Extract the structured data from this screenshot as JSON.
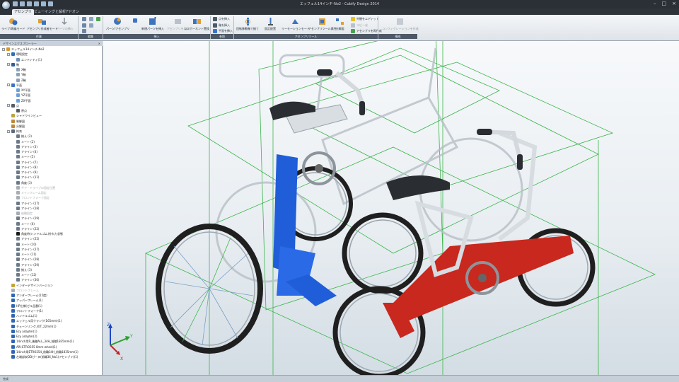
{
  "window": {
    "title": "エッフェル14インチ-No2 - Cubify Design 2014"
  },
  "tabs": [
    {
      "label": "アセンブリ"
    },
    {
      "label": "ビューイングと解析"
    },
    {
      "label": "アドオン"
    }
  ],
  "ribbon": {
    "buttons": {
      "insert_mode": "ライブ/再編モード",
      "assembly_mode": "アセンブリ作成者モード",
      "part_insert": "パーツの挿入",
      "parts_assembly": "パーツ/アセンブリ",
      "new_part_insert": "新規パーツを挿入",
      "create_assembly": "アセンブリを作成",
      "component_replace": "コンポーネント置換",
      "rotate_align": "回転移動軸で揃て",
      "fixed_place": "固定配置",
      "motion_mode": "リーモーションモード",
      "assembly_tools": "アセンブリツール属性",
      "analysis": "分解図",
      "reconfigure": "コンフィグレーションを作成"
    },
    "small": {
      "point_insert": "点を挿入",
      "axis_insert": "軸を挿入",
      "plane_insert": "平面を挿入",
      "color_edit": "外観をエディット",
      "xcopy": "コピー化",
      "regenerate": "アセンブリを再作成"
    },
    "groups": {
      "work": "作業",
      "edit": "編集",
      "insert": "挿入",
      "reference": "参照",
      "assembly_tools": "アセンブリツール",
      "configuration": "構成"
    }
  },
  "panel": {
    "title": "デザインエクスプローラー"
  },
  "tree": [
    {
      "label": "エッフェル14インチ-No2",
      "level": 0,
      "expanded": true,
      "icon_color": "#d79a2a"
    },
    {
      "label": "環境設定",
      "level": 1,
      "expanded": true,
      "icon_color": "#2a6fb7"
    },
    {
      "label": "エンティティ(1)",
      "level": 2,
      "icon_color": "#6d8fb6"
    },
    {
      "label": "軸",
      "level": 1,
      "expanded": true,
      "icon_color": "#2f5c9a"
    },
    {
      "label": "X軸",
      "level": 2,
      "icon_color": "#8aa1b8"
    },
    {
      "label": "Y軸",
      "level": 2,
      "icon_color": "#8aa1b8"
    },
    {
      "label": "Z軸",
      "level": 2,
      "icon_color": "#8aa1b8"
    },
    {
      "label": "平面",
      "level": 1,
      "expanded": true,
      "icon_color": "#3b72c5"
    },
    {
      "label": "XY平面",
      "level": 2,
      "icon_color": "#6d9fd8"
    },
    {
      "label": "YZ平面",
      "level": 2,
      "icon_color": "#6d9fd8"
    },
    {
      "label": "ZX平面",
      "level": 2,
      "icon_color": "#6d9fd8"
    },
    {
      "label": "点",
      "level": 1,
      "expanded": true,
      "icon_color": "#555b63"
    },
    {
      "label": "原点",
      "level": 2,
      "icon_color": "#555b63"
    },
    {
      "label": "シャドウインビュー",
      "level": 1,
      "icon_color": "#b8a640"
    },
    {
      "label": "制御図",
      "level": 1,
      "icon_color": "#c0863a"
    },
    {
      "label": "分解図",
      "level": 1,
      "icon_color": "#c0863a"
    },
    {
      "label": "拘束",
      "level": 1,
      "expanded": true,
      "icon_color": "#5a6b7d"
    },
    {
      "label": "揃え (2)",
      "level": 2,
      "icon_color": "#6b7a8a"
    },
    {
      "label": "メート (2)",
      "level": 2,
      "icon_color": "#6b7a8a"
    },
    {
      "label": "アライン (3)",
      "level": 2,
      "icon_color": "#6b7a8a"
    },
    {
      "label": "アライン (4)",
      "level": 2,
      "icon_color": "#6b7a8a"
    },
    {
      "label": "メート (5)",
      "level": 2,
      "icon_color": "#6b7a8a"
    },
    {
      "label": "アライン (7)",
      "level": 2,
      "icon_color": "#6b7a8a"
    },
    {
      "label": "アライン (8)",
      "level": 2,
      "icon_color": "#6b7a8a"
    },
    {
      "label": "アライン (9)",
      "level": 2,
      "icon_color": "#6b7a8a"
    },
    {
      "label": "アライン (11)",
      "level": 2,
      "icon_color": "#6b7a8a"
    },
    {
      "label": "角度 (3)",
      "level": 2,
      "icon_color": "#6b7a8a"
    },
    {
      "label": "ギア・ドライブの固定位置",
      "level": 2,
      "dim": true,
      "icon_color": "#a8adb3"
    },
    {
      "label": "メインフレーム固定",
      "level": 2,
      "dim": true,
      "icon_color": "#a8adb3"
    },
    {
      "label": "フロントフォーク固定",
      "level": 2,
      "dim": true,
      "icon_color": "#a8adb3"
    },
    {
      "label": "アライン (17)",
      "level": 2,
      "icon_color": "#6b7a8a"
    },
    {
      "label": "アライン (18)",
      "level": 2,
      "icon_color": "#6b7a8a"
    },
    {
      "label": "後輪固定",
      "level": 2,
      "dim": true,
      "icon_color": "#a8adb3"
    },
    {
      "label": "アライン (19)",
      "level": 2,
      "icon_color": "#6b7a8a"
    },
    {
      "label": "メート (6)",
      "level": 2,
      "icon_color": "#6b7a8a"
    },
    {
      "label": "アライン (22)",
      "level": 2,
      "icon_color": "#6b7a8a"
    },
    {
      "label": "角度特(ハンドルゴム)外れた状態",
      "level": 2,
      "icon_color": "#1a1a1a"
    },
    {
      "label": "アライン (25)",
      "level": 2,
      "icon_color": "#6b7a8a"
    },
    {
      "label": "メート (10)",
      "level": 2,
      "icon_color": "#6b7a8a"
    },
    {
      "label": "アライン (27)",
      "level": 2,
      "icon_color": "#6b7a8a"
    },
    {
      "label": "メート (11)",
      "level": 2,
      "icon_color": "#6b7a8a"
    },
    {
      "label": "アライン (28)",
      "level": 2,
      "icon_color": "#6b7a8a"
    },
    {
      "label": "アライン (29)",
      "level": 2,
      "icon_color": "#6b7a8a"
    },
    {
      "label": "揃え (3)",
      "level": 2,
      "icon_color": "#6b7a8a"
    },
    {
      "label": "メート (12)",
      "level": 2,
      "icon_color": "#6b7a8a"
    },
    {
      "label": "アライン (30)",
      "level": 2,
      "icon_color": "#6b7a8a"
    },
    {
      "label": "インターデザインバージョン",
      "level": 1,
      "icon_color": "#c8a23a"
    },
    {
      "label": "フロントフレーム",
      "level": 1,
      "dim": true,
      "icon_color": "#a8adb3"
    },
    {
      "label": "アンダーフレーム(15度)",
      "level": 1,
      "icon_color": "#2e66b5"
    },
    {
      "label": "アッパーフレーム(1)",
      "level": 1,
      "icon_color": "#2e66b5"
    },
    {
      "label": "HP仕様(ゼル品番(1)",
      "level": 1,
      "icon_color": "#2e66b5"
    },
    {
      "label": "フロントフォーク(1)",
      "level": 1,
      "icon_color": "#2e66b5"
    },
    {
      "label": "ハンドルゴム(1)",
      "level": 1,
      "icon_color": "#2e66b5"
    },
    {
      "label": "エッフェル用クランク(165mm)(1)",
      "level": 1,
      "icon_color": "#2e66b5"
    },
    {
      "label": "チェーンリング_KIT_22mm(1)",
      "level": 1,
      "icon_color": "#2e66b5"
    },
    {
      "label": "Ezy adapter(1)",
      "level": 1,
      "icon_color": "#2e66b5"
    },
    {
      "label": "Ezy adapter(2)",
      "level": 1,
      "icon_color": "#2e66b5"
    },
    {
      "label": "14inch用R_後輪ALL_34H_前輪1835mm(1)",
      "level": 1,
      "icon_color": "#2e66b5"
    },
    {
      "label": "ARI-ETRO355 8mm-wheel(1)",
      "level": 1,
      "icon_color": "#2e66b5"
    },
    {
      "label": "14inch用ETRO254_前輪34H_前輪1835mm(1)",
      "level": 1,
      "icon_color": "#2e66b5"
    },
    {
      "label": "左端部安DDガーヌ(前輪36_No1(アセンブリ)(1)",
      "level": 1,
      "icon_color": "#2e66b5"
    }
  ],
  "status": {
    "text": "完成"
  },
  "colors": {
    "accent": "#2c5ea8",
    "blue_frame": "#1f5ed8",
    "red_frame": "#c8281e",
    "grid": "#3bb54a"
  }
}
